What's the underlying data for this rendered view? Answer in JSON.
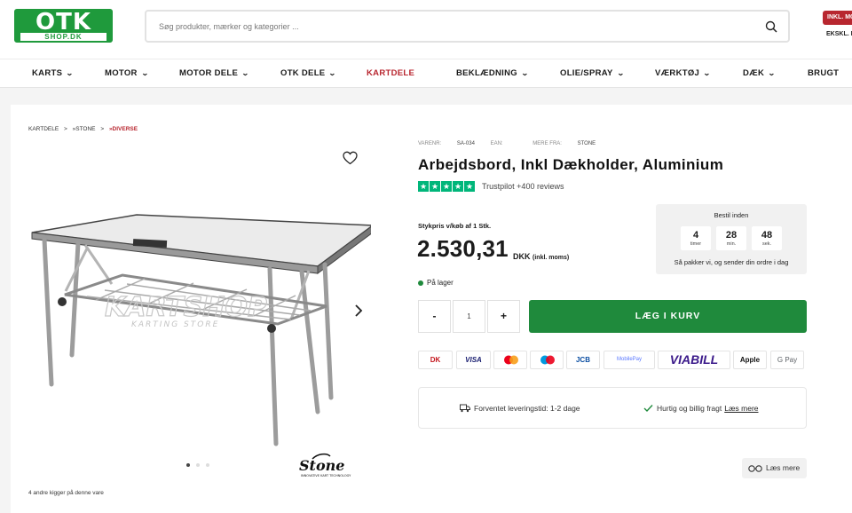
{
  "header": {
    "logo_top": "OTK",
    "logo_bottom": "SHOP.DK",
    "search_placeholder": "Søg produkter, mærker og kategorier ...",
    "vat_inkl": "INKL. MO",
    "vat_ekskl": "EKSKL. M"
  },
  "nav": [
    {
      "label": "KARTS",
      "dropdown": true
    },
    {
      "label": "MOTOR",
      "dropdown": true
    },
    {
      "label": "MOTOR DELE",
      "dropdown": true
    },
    {
      "label": "OTK DELE",
      "dropdown": true
    },
    {
      "label": "KARTDELE",
      "dropdown": false,
      "active": true
    },
    {
      "label": "BEKLÆDNING",
      "dropdown": true
    },
    {
      "label": "OLIE/SPRAY",
      "dropdown": true
    },
    {
      "label": "VÆRKTØJ",
      "dropdown": true
    },
    {
      "label": "DÆK",
      "dropdown": true
    },
    {
      "label": "BRUGT",
      "dropdown": false
    }
  ],
  "breadcrumb": [
    "KARTDELE",
    ">",
    "»STONE",
    ">",
    "»DIVERSE"
  ],
  "product": {
    "varenr_label": "VARENR:",
    "varenr": "SA-034",
    "ean_label": "EAN:",
    "ean": "",
    "more_label": "MERE FRA:",
    "brand": "STONE",
    "title": "Arbejdsbord, Inkl Dækholder, Aluminium",
    "trustpilot": "Trustpilot +400  reviews",
    "rating_stars": 5,
    "unit_price_label": "Stykpris v/køb af 1 Stk.",
    "price": "2.530,31",
    "currency": "DKK",
    "currency_note": "(inkl. moms)",
    "stock": "På lager",
    "quantity": "1",
    "add_to_cart": "LÆG I KURV",
    "image_watermark": "KARTSHOP",
    "image_watermark_sub": "KARTING STORE",
    "brand_logo_text": "Stone",
    "brand_logo_sub": "INNOVATIVE KART TECHNOLOGY",
    "viewers": "4 andre kigger på denne vare",
    "image_dots": 3
  },
  "order_box": {
    "heading": "Bestil inden",
    "hours": "4",
    "hours_unit": "timer",
    "minutes": "28",
    "minutes_unit": "min.",
    "seconds": "48",
    "seconds_unit": "sek.",
    "footer": "Så pakker vi, og sender din ordre i dag"
  },
  "payments": [
    "DK",
    "VISA",
    "Mastercard",
    "Maestro",
    "JCB",
    "MobilePay",
    "VIABILL",
    "Apple Pay",
    "G Pay"
  ],
  "shipping": {
    "delivery": "Forventet leveringstid: 1-2 dage",
    "fast": "Hurtig og billig fragt",
    "read_more": "Læs mere"
  },
  "read_more_button": "Læs mere",
  "colors": {
    "green": "#1f8a3c",
    "logo_green": "#1f9a3c",
    "red": "#b8262f",
    "trustpilot": "#00b67a"
  }
}
